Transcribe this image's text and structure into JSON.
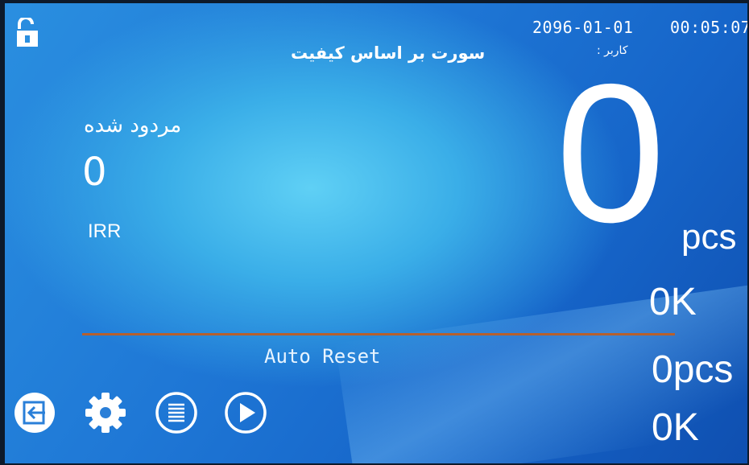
{
  "status_bar": {
    "date": "2096-01-01",
    "time": "00:05:07",
    "title": "سورت بر اساس کیفیت",
    "user_label": ": کاربر"
  },
  "left_panel": {
    "rejected_label": "مردود شده",
    "rejected_count": "0",
    "currency": "IRR"
  },
  "main_counter": {
    "count": "0",
    "unit": "pcs",
    "amount": "0K"
  },
  "lower": {
    "mode": "Auto Reset",
    "count_text": "0pcs",
    "amount": "0K"
  },
  "toolbar": {
    "icons": [
      "exit-icon",
      "gear-icon",
      "list-icon",
      "play-icon"
    ]
  },
  "colors": {
    "background": "#1f78d6",
    "separator": "#b5602e",
    "text": "#ffffff"
  }
}
